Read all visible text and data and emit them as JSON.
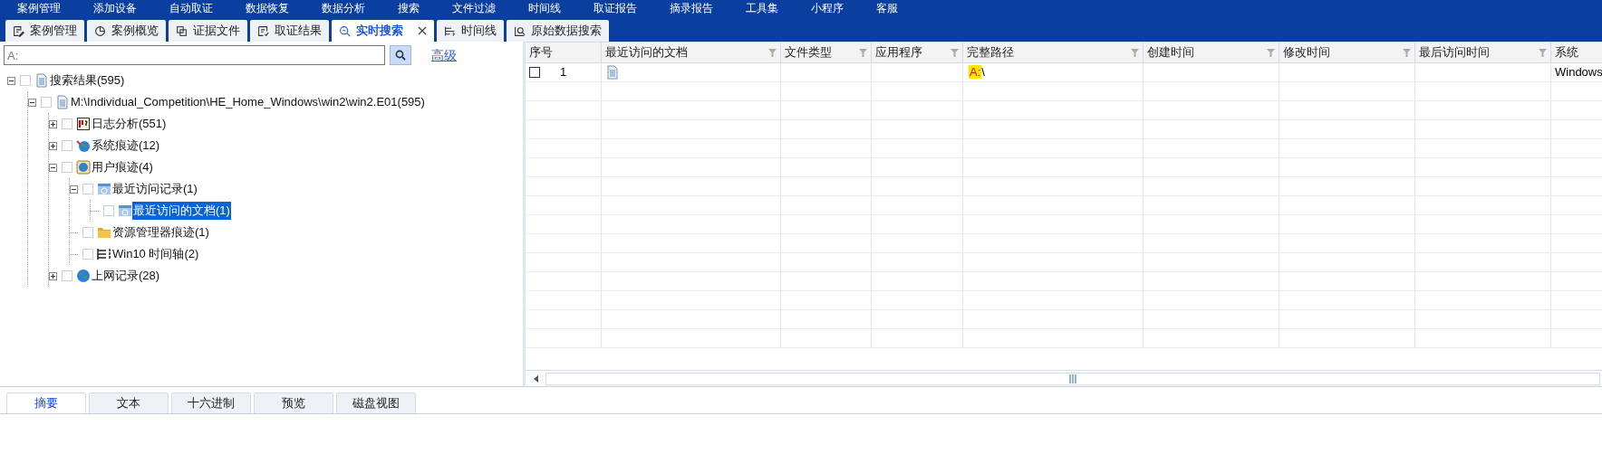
{
  "menu": [
    "案例管理",
    "添加设备",
    "自动取证",
    "数据恢复",
    "数据分析",
    "搜索",
    "文件过滤",
    "时间线",
    "取证报告",
    "摘录报告",
    "工具集",
    "小程序",
    "客服"
  ],
  "tabs": [
    {
      "label": "案例管理",
      "kind": "edit",
      "selected": false
    },
    {
      "label": "案例概览",
      "kind": "pie",
      "selected": false
    },
    {
      "label": "证据文件",
      "kind": "copy",
      "selected": false
    },
    {
      "label": "取证结果",
      "kind": "result",
      "selected": false
    },
    {
      "label": "实时搜索",
      "kind": "search",
      "selected": true
    },
    {
      "label": "时间线",
      "kind": "timeline",
      "selected": false
    },
    {
      "label": "原始数据搜索",
      "kind": "rawsearch",
      "selected": false
    }
  ],
  "search": {
    "value": "A:",
    "advanced": "高级"
  },
  "tree": [
    {
      "label": "搜索结果(595)",
      "kind": "doc",
      "checked": false,
      "expanded": true,
      "selected": false,
      "children": [
        {
          "label": "M:\\Individual_Competition\\HE_Home_Windows\\win2\\win2.E01(595)",
          "kind": "doc",
          "checked": false,
          "expanded": true,
          "selected": false,
          "children": [
            {
              "label": "日志分析(551)",
              "kind": "log",
              "checked": false,
              "expanded": false,
              "selected": false
            },
            {
              "label": "系统痕迹(12)",
              "kind": "system",
              "checked": false,
              "expanded": false,
              "selected": false
            },
            {
              "label": "用户痕迹(4)",
              "kind": "user",
              "checked": false,
              "expanded": true,
              "selected": false,
              "children": [
                {
                  "label": "最近访问记录(1)",
                  "kind": "recent",
                  "checked": false,
                  "expanded": true,
                  "selected": false,
                  "children": [
                    {
                      "label": "最近访问的文档(1)",
                      "kind": "recent",
                      "checked": false,
                      "selected": true
                    }
                  ]
                },
                {
                  "label": "资源管理器痕迹(1)",
                  "kind": "folder",
                  "checked": false,
                  "selected": false
                },
                {
                  "label": "Win10 时间轴(2)",
                  "kind": "timeline",
                  "checked": false,
                  "selected": false
                }
              ]
            },
            {
              "label": "上网记录(28)",
              "kind": "globe",
              "checked": false,
              "expanded": false,
              "selected": false
            }
          ]
        }
      ]
    }
  ],
  "table": {
    "columns": [
      "序号",
      "最近访问的文档",
      "文件类型",
      "应用程序",
      "完整路径",
      "创建时间",
      "修改时间",
      "最后访问时间",
      "系统"
    ],
    "rows": [
      {
        "checked": false,
        "number": "1",
        "path_match": "A:",
        "path_rest": "\\",
        "system": "Windows"
      }
    ]
  },
  "bottom_tabs": [
    {
      "label": "摘要",
      "selected": true
    },
    {
      "label": "文本",
      "selected": false
    },
    {
      "label": "十六进制",
      "selected": false
    },
    {
      "label": "预览",
      "selected": false
    },
    {
      "label": "磁盘视图",
      "selected": false
    }
  ]
}
